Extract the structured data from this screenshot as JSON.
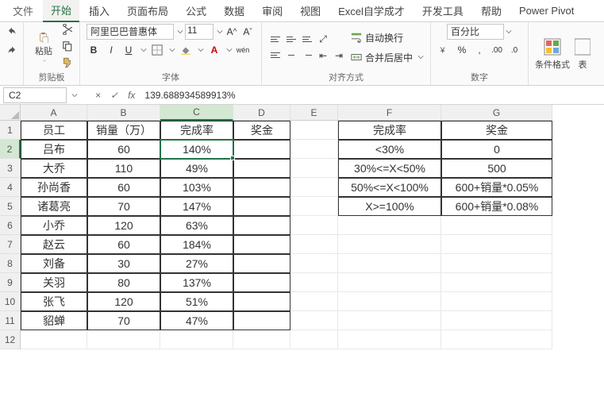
{
  "menu": {
    "file": "文件",
    "home": "开始",
    "insert": "插入",
    "page": "页面布局",
    "formula": "公式",
    "data": "数据",
    "review": "审阅",
    "view": "视图",
    "excel": "Excel自学成才",
    "dev": "开发工具",
    "help": "帮助",
    "pivot": "Power Pivot"
  },
  "ribbon": {
    "clipboard": {
      "paste": "粘贴",
      "label": "剪贴板"
    },
    "font": {
      "name": "阿里巴巴普惠体",
      "size": "11",
      "label": "字体"
    },
    "align": {
      "wrap": "自动换行",
      "merge": "合并后居中",
      "label": "对齐方式"
    },
    "number": {
      "format": "百分比",
      "label": "数字"
    },
    "styles": {
      "cond": "条件格式",
      "table": "表"
    }
  },
  "fb": {
    "ref": "C2",
    "val": "139.688934589913%"
  },
  "cols": [
    "A",
    "B",
    "C",
    "D",
    "E",
    "F",
    "G"
  ],
  "rows": [
    "1",
    "2",
    "3",
    "4",
    "5",
    "6",
    "7",
    "8",
    "9",
    "10",
    "11",
    "12"
  ],
  "sheet": {
    "h1": {
      "A": "员工",
      "B": "销量（万）",
      "C": "完成率",
      "D": "奖金",
      "F": "完成率",
      "G": "奖金"
    },
    "r2": {
      "A": "吕布",
      "B": "60",
      "C": "140%",
      "F": "<30%",
      "G": "0"
    },
    "r3": {
      "A": "大乔",
      "B": "110",
      "C": "49%",
      "F": "30%<=X<50%",
      "G": "500"
    },
    "r4": {
      "A": "孙尚香",
      "B": "60",
      "C": "103%",
      "F": "50%<=X<100%",
      "G": "600+销量*0.05%"
    },
    "r5": {
      "A": "诸葛亮",
      "B": "70",
      "C": "147%",
      "F": "X>=100%",
      "G": "600+销量*0.08%"
    },
    "r6": {
      "A": "小乔",
      "B": "120",
      "C": "63%"
    },
    "r7": {
      "A": "赵云",
      "B": "60",
      "C": "184%"
    },
    "r8": {
      "A": "刘备",
      "B": "30",
      "C": "27%"
    },
    "r9": {
      "A": "关羽",
      "B": "80",
      "C": "137%"
    },
    "r10": {
      "A": "张飞",
      "B": "120",
      "C": "51%"
    },
    "r11": {
      "A": "貂蝉",
      "B": "70",
      "C": "47%"
    }
  },
  "chart_data": {
    "type": "table",
    "title": "员工销量与完成率 / 奖金规则",
    "employees": {
      "columns": [
        "员工",
        "销量（万）",
        "完成率",
        "奖金"
      ],
      "rows": [
        [
          "吕布",
          60,
          "140%",
          null
        ],
        [
          "大乔",
          110,
          "49%",
          null
        ],
        [
          "孙尚香",
          60,
          "103%",
          null
        ],
        [
          "诸葛亮",
          70,
          "147%",
          null
        ],
        [
          "小乔",
          120,
          "63%",
          null
        ],
        [
          "赵云",
          60,
          "184%",
          null
        ],
        [
          "刘备",
          30,
          "27%",
          null
        ],
        [
          "关羽",
          80,
          "137%",
          null
        ],
        [
          "张飞",
          120,
          "51%",
          null
        ],
        [
          "貂蝉",
          70,
          "47%",
          null
        ]
      ]
    },
    "bonus_rules": {
      "columns": [
        "完成率",
        "奖金"
      ],
      "rows": [
        [
          "<30%",
          "0"
        ],
        [
          "30%<=X<50%",
          "500"
        ],
        [
          "50%<=X<100%",
          "600+销量*0.05%"
        ],
        [
          "X>=100%",
          "600+销量*0.08%"
        ]
      ]
    }
  }
}
